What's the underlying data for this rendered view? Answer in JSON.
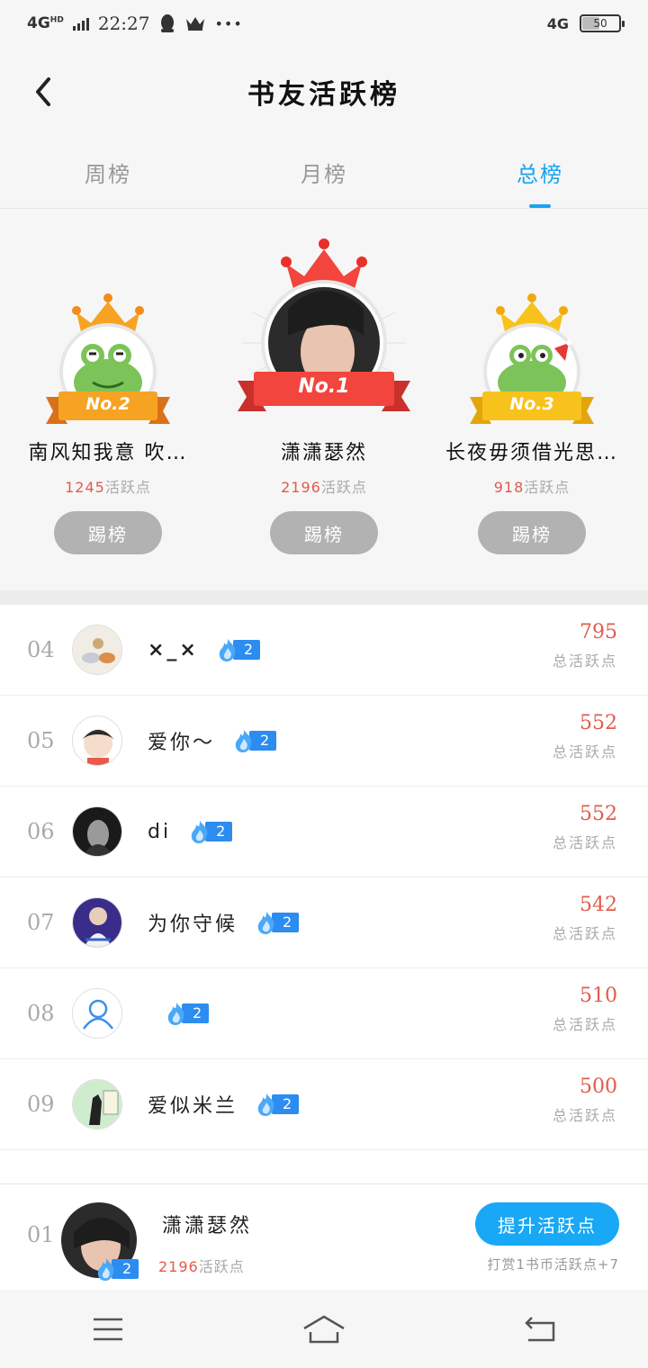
{
  "status_bar": {
    "network_left": "4G",
    "network_hd": "HD",
    "time": "22:27",
    "more": "•••",
    "network_right": "4G",
    "battery": "50"
  },
  "header": {
    "title": "书友活跃榜"
  },
  "tabs": [
    {
      "label": "周榜",
      "active": false
    },
    {
      "label": "月榜",
      "active": false
    },
    {
      "label": "总榜",
      "active": true
    }
  ],
  "podium": {
    "first": {
      "rank_label": "No.1",
      "name": "潇潇瑟然",
      "points": "2196",
      "points_unit": "活跃点",
      "kick_label": "踢榜"
    },
    "second": {
      "rank_label": "No.2",
      "name": "南风知我意 吹…",
      "points": "1245",
      "points_unit": "活跃点",
      "kick_label": "踢榜"
    },
    "third": {
      "rank_label": "No.3",
      "name": "长夜毋须借光思…",
      "points": "918",
      "points_unit": "活跃点",
      "kick_label": "踢榜"
    }
  },
  "list": [
    {
      "rank": "04",
      "name": "×_×",
      "level": "2",
      "points": "795",
      "points_label": "总活跃点"
    },
    {
      "rank": "05",
      "name": "爱你～",
      "level": "2",
      "points": "552",
      "points_label": "总活跃点"
    },
    {
      "rank": "06",
      "name": "di",
      "level": "2",
      "points": "552",
      "points_label": "总活跃点"
    },
    {
      "rank": "07",
      "name": "为你守候",
      "level": "2",
      "points": "542",
      "points_label": "总活跃点"
    },
    {
      "rank": "08",
      "name": "",
      "level": "2",
      "points": "510",
      "points_label": "总活跃点"
    },
    {
      "rank": "09",
      "name": "爱似米兰",
      "level": "2",
      "points": "500",
      "points_label": "总活跃点"
    }
  ],
  "my_rank": {
    "rank": "01",
    "name": "潇潇瑟然",
    "level": "2",
    "points": "2196",
    "points_unit": "活跃点",
    "boost_label": "提升活跃点",
    "tip": "打赏1书币活跃点+7"
  },
  "colors": {
    "accent": "#1aa3ef",
    "points_red": "#e35a4a",
    "badge_blue": "#2c8cf0",
    "kick_gray": "#b2b2b2"
  }
}
